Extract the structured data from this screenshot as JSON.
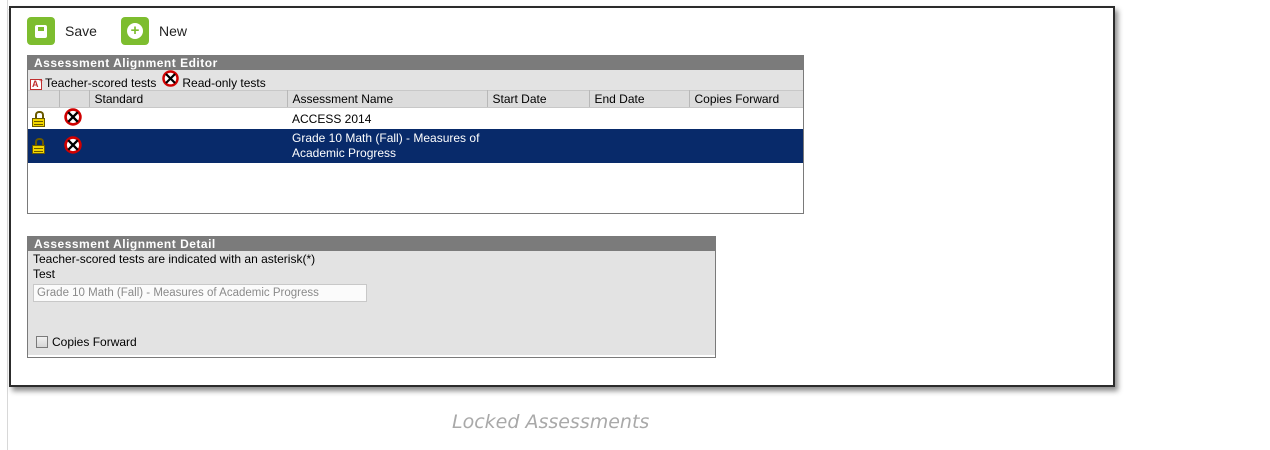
{
  "toolbar": {
    "save_label": "Save",
    "new_label": "New"
  },
  "editor": {
    "title": "Assessment Alignment Editor",
    "legend": {
      "teacher_scored": "Teacher-scored tests",
      "read_only": "Read-only tests"
    },
    "columns": [
      "",
      "",
      "Standard",
      "Assessment Name",
      "Start Date",
      "End Date",
      "Copies Forward"
    ],
    "rows": [
      {
        "locked": true,
        "read_only": true,
        "standard": "",
        "assessment_name": "ACCESS 2014",
        "start_date": "",
        "end_date": "",
        "copies_forward": "",
        "selected": false
      },
      {
        "locked": true,
        "read_only": true,
        "standard": "",
        "assessment_name": "Grade 10 Math (Fall) - Measures of Academic Progress",
        "start_date": "",
        "end_date": "",
        "copies_forward": "",
        "selected": true
      }
    ]
  },
  "detail": {
    "title": "Assessment Alignment Detail",
    "note": "Teacher-scored tests are indicated with an asterisk(*)",
    "test_label": "Test",
    "test_value": "Grade  10 Math (Fall)  -  Measures of Academic Progress",
    "copies_forward_label": "Copies Forward",
    "copies_forward_checked": false
  },
  "caption": "Locked Assessments",
  "colors": {
    "selected_row": "#082a6a",
    "panel_header": "#7b7b7b",
    "toolbar_icon": "#7dbd2f"
  }
}
